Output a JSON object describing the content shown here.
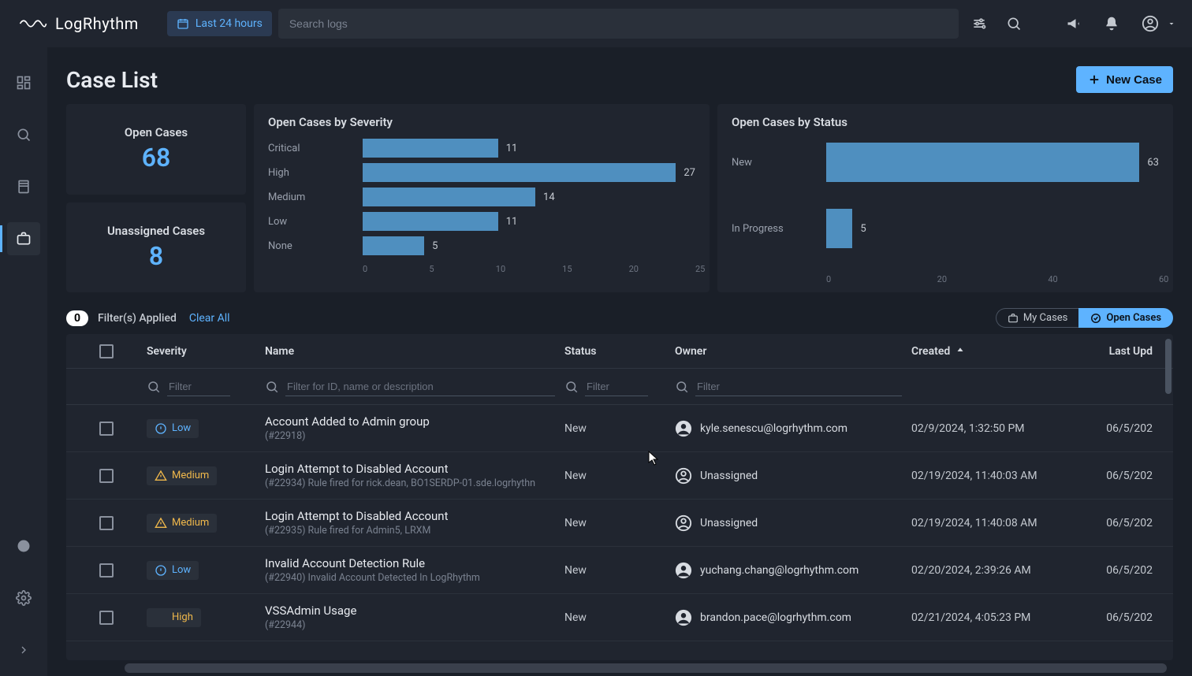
{
  "brand": "LogRhythm",
  "topbar": {
    "timerange": "Last 24 hours",
    "search_placeholder": "Search logs"
  },
  "page": {
    "title": "Case List",
    "new_case_label": "New Case"
  },
  "stats": {
    "open_label": "Open Cases",
    "open_value": "68",
    "unassigned_label": "Unassigned Cases",
    "unassigned_value": "8"
  },
  "filters": {
    "count": "0",
    "applied_label": "Filter(s) Applied",
    "clear_all": "Clear All",
    "my_cases": "My Cases",
    "open_cases": "Open Cases"
  },
  "table": {
    "headers": {
      "severity": "Severity",
      "name": "Name",
      "status": "Status",
      "owner": "Owner",
      "created": "Created",
      "last_updated": "Last Upd"
    },
    "filter_placeholders": {
      "severity": "Filter",
      "name": "Filter for ID, name or description",
      "status": "Filter",
      "owner": "Filter"
    },
    "rows": [
      {
        "severity": "Low",
        "name": "Account Added to Admin group",
        "sub": "(#22918)",
        "status": "New",
        "owner": "kyle.senescu@logrhythm.com",
        "owner_kind": "user",
        "created": "02/9/2024, 1:32:50 PM",
        "last_updated": "06/5/202"
      },
      {
        "severity": "Medium",
        "name": "Login Attempt to Disabled Account",
        "sub": "(#22934) Rule fired for rick.dean, BO1SERDP-01.sde.logrhythn",
        "status": "New",
        "owner": "Unassigned",
        "owner_kind": "unassigned",
        "created": "02/19/2024, 11:40:03 AM",
        "last_updated": "06/5/202"
      },
      {
        "severity": "Medium",
        "name": "Login Attempt to Disabled Account",
        "sub": "(#22935) Rule fired for Admin5, LRXM",
        "status": "New",
        "owner": "Unassigned",
        "owner_kind": "unassigned",
        "created": "02/19/2024, 11:40:08 AM",
        "last_updated": "06/5/202"
      },
      {
        "severity": "Low",
        "name": "Invalid Account Detection Rule",
        "sub": "(#22940) Invalid Account Detected In LogRhythm",
        "status": "New",
        "owner": "yuchang.chang@logrhythm.com",
        "owner_kind": "user",
        "created": "02/20/2024, 2:39:26 AM",
        "last_updated": "06/5/202"
      },
      {
        "severity": "High",
        "name": "VSSAdmin Usage",
        "sub": "(#22944)",
        "status": "New",
        "owner": "brandon.pace@logrhythm.com",
        "owner_kind": "user",
        "created": "02/21/2024, 4:05:23 PM",
        "last_updated": "06/5/202"
      }
    ]
  },
  "chart_data": [
    {
      "type": "bar",
      "orientation": "horizontal",
      "title": "Open Cases by Severity",
      "categories": [
        "Critical",
        "High",
        "Medium",
        "Low",
        "None"
      ],
      "values": [
        11,
        27,
        14,
        11,
        5
      ],
      "xlim": [
        0,
        27
      ],
      "xticks": [
        0,
        5,
        10,
        15,
        20,
        25
      ],
      "color": "#4f8fbf"
    },
    {
      "type": "bar",
      "orientation": "horizontal",
      "title": "Open Cases by Status",
      "categories": [
        "New",
        "In Progress"
      ],
      "values": [
        63,
        5
      ],
      "xlim": [
        0,
        63
      ],
      "xticks": [
        0,
        20,
        40,
        60
      ],
      "color": "#4f8fbf"
    }
  ]
}
